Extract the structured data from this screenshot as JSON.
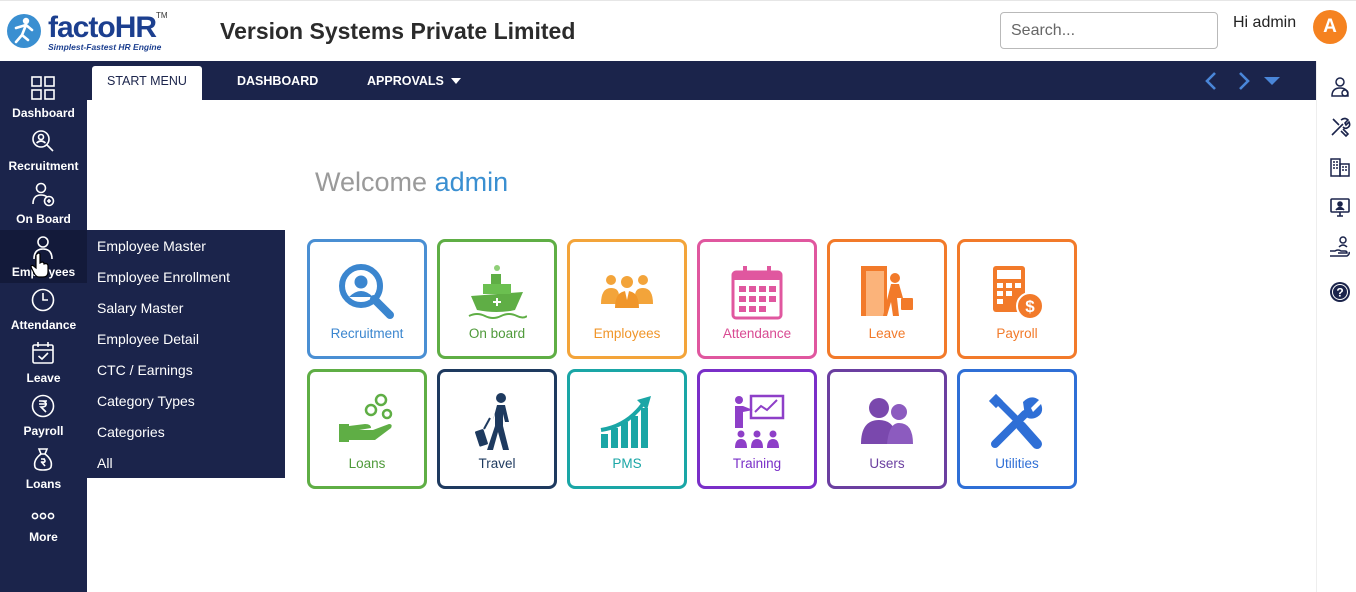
{
  "header": {
    "logo_text_a": "facto",
    "logo_text_b": "HR",
    "logo_tm": "TM",
    "logo_tagline": "Simplest-Fastest HR Engine",
    "company_name": "Version Systems Private Limited",
    "search_placeholder": "Search...",
    "greeting": "Hi admin",
    "avatar_initial": "A"
  },
  "sidebar": {
    "items": [
      {
        "label": "Dashboard",
        "icon": "dashboard-grid-icon"
      },
      {
        "label": "Recruitment",
        "icon": "recruitment-search-icon"
      },
      {
        "label": "On Board",
        "icon": "onboard-person-icon"
      },
      {
        "label": "Employees",
        "icon": "employee-person-icon"
      },
      {
        "label": "Attendance",
        "icon": "clock-icon"
      },
      {
        "label": "Leave",
        "icon": "calendar-check-icon"
      },
      {
        "label": "Payroll",
        "icon": "rupee-icon"
      },
      {
        "label": "Loans",
        "icon": "money-bag-icon"
      },
      {
        "label": "More",
        "icon": "more-dots-icon"
      }
    ]
  },
  "navbar": {
    "tabs": [
      {
        "label": "START MENU"
      },
      {
        "label": "DASHBOARD"
      },
      {
        "label": "APPROVALS"
      }
    ]
  },
  "flyout": {
    "items": [
      "Employee Master",
      "Employee Enrollment",
      "Salary Master",
      "Employee Detail",
      "CTC / Earnings",
      "Category Types",
      "Categories",
      "All"
    ]
  },
  "main": {
    "welcome_prefix": "Welcome",
    "welcome_name": "admin",
    "tiles": [
      {
        "label": "Recruitment",
        "color": "#4a8fd3",
        "icon": "recruitment-magnifier-icon"
      },
      {
        "label": "On board",
        "color": "#5fae45",
        "icon": "ship-icon"
      },
      {
        "label": "Employees",
        "color": "#f3a43a",
        "icon": "employees-group-icon"
      },
      {
        "label": "Attendance",
        "color": "#e0579f",
        "icon": "calendar-icon"
      },
      {
        "label": "Leave",
        "color": "#f27a2a",
        "icon": "exit-door-icon"
      },
      {
        "label": "Payroll",
        "color": "#f27a2a",
        "icon": "calculator-dollar-icon"
      },
      {
        "label": "Loans",
        "color": "#5fae45",
        "icon": "hand-coins-icon"
      },
      {
        "label": "Travel",
        "color": "#1e3a5f",
        "icon": "traveler-icon"
      },
      {
        "label": "PMS",
        "color": "#1aa6a6",
        "icon": "growth-chart-icon"
      },
      {
        "label": "Training",
        "color": "#7a2fc8",
        "icon": "training-board-icon"
      },
      {
        "label": "Users",
        "color": "#6b3fa0",
        "icon": "users-icon"
      },
      {
        "label": "Utilities",
        "color": "#2f6fd6",
        "icon": "tools-icon"
      }
    ]
  },
  "rail": {
    "icons": [
      "user-settings-icon",
      "tools-icon",
      "building-icon",
      "monitor-icon",
      "hand-user-icon",
      "help-icon"
    ]
  }
}
